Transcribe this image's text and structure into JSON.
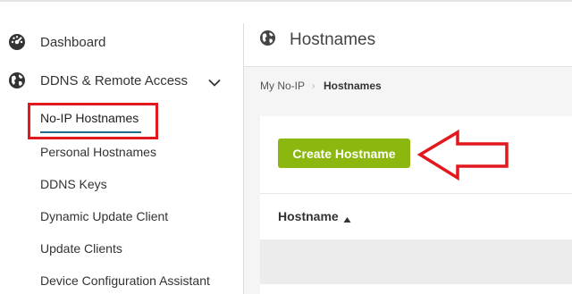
{
  "sidebar": {
    "dashboard_label": "Dashboard",
    "ddns_label": "DDNS & Remote Access",
    "sub_items": [
      "No-IP Hostnames",
      "Personal Hostnames",
      "DDNS Keys",
      "Dynamic Update Client",
      "Update Clients",
      "Device Configuration Assistant"
    ],
    "active_item": "No-IP Hostnames"
  },
  "header": {
    "title": "Hostnames",
    "icon": "globe-icon"
  },
  "breadcrumb": {
    "home": "My No-IP",
    "separator": "›",
    "current": "Hostnames"
  },
  "main": {
    "create_button_label": "Create Hostname",
    "table": {
      "column_header": "Hostname",
      "sort": "ascending"
    }
  },
  "colors": {
    "accent_green": "#8cb70e",
    "annotation_red": "#e1191f",
    "active_underline": "#1c6c8b"
  },
  "icons": [
    "dashboard-gauge-icon",
    "globe-icon",
    "chevron-down-icon",
    "sort-up-icon"
  ]
}
